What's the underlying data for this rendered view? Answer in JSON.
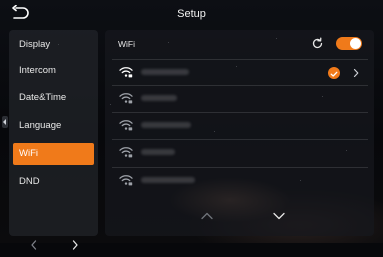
{
  "header": {
    "title": "Setup"
  },
  "sidebar": {
    "items": [
      {
        "label": "Display",
        "active": false
      },
      {
        "label": "Intercom",
        "active": false
      },
      {
        "label": "Date&Time",
        "active": false
      },
      {
        "label": "Language",
        "active": false
      },
      {
        "label": "WiFi",
        "active": true
      },
      {
        "label": "DND",
        "active": false
      }
    ]
  },
  "wifi_panel": {
    "label": "WiFi",
    "enabled": true,
    "networks": [
      {
        "connected": true
      },
      {
        "connected": false
      },
      {
        "connected": false
      },
      {
        "connected": false
      },
      {
        "connected": false
      }
    ]
  },
  "icons": {
    "back": "back-arrow-icon",
    "refresh": "refresh-icon",
    "wifi": "wifi-locked-icon",
    "check": "check-circle-icon"
  },
  "colors": {
    "accent": "#f07a1a",
    "panel": "#202228",
    "text": "#ffffff"
  }
}
